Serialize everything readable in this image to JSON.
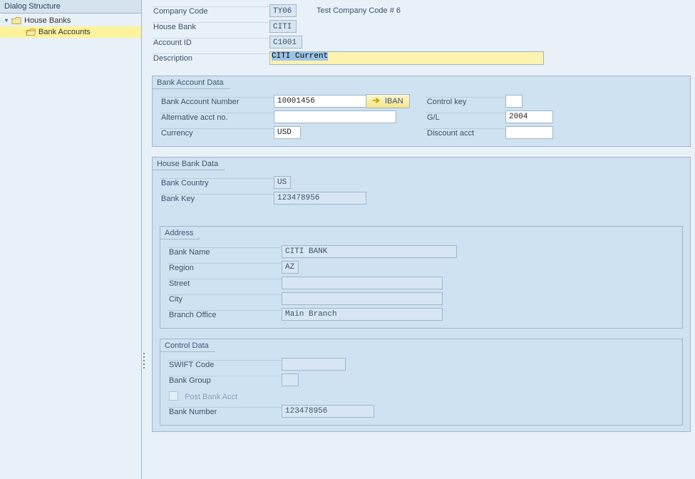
{
  "sidebar": {
    "header": "Dialog Structure",
    "items": [
      {
        "label": "House Banks",
        "expanded": true,
        "selected": false
      },
      {
        "label": "Bank Accounts",
        "expanded": false,
        "selected": true
      }
    ]
  },
  "header_fields": {
    "company_code_label": "Company Code",
    "company_code_value": "TY06",
    "company_code_desc": "Test Company Code # 6",
    "house_bank_label": "House Bank",
    "house_bank_value": "CITI",
    "account_id_label": "Account ID",
    "account_id_value": "C1001",
    "description_label": "Description",
    "description_value": "CITI Current"
  },
  "bank_account_data": {
    "title": "Bank Account Data",
    "bank_account_number_label": "Bank Account Number",
    "bank_account_number_value": "10001456",
    "iban_button": "IBAN",
    "control_key_label": "Control key",
    "control_key_value": "",
    "alt_acct_label": "Alternative acct no.",
    "alt_acct_value": "",
    "gl_label": "G/L",
    "gl_value": "2004",
    "currency_label": "Currency",
    "currency_value": "USD",
    "discount_acct_label": "Discount acct",
    "discount_acct_value": ""
  },
  "house_bank_data": {
    "title": "House Bank Data",
    "bank_country_label": "Bank Country",
    "bank_country_value": "US",
    "bank_key_label": "Bank Key",
    "bank_key_value": "123478956",
    "address": {
      "title": "Address",
      "bank_name_label": "Bank Name",
      "bank_name_value": "CITI BANK",
      "region_label": "Region",
      "region_value": "AZ",
      "street_label": "Street",
      "street_value": "",
      "city_label": "City",
      "city_value": "",
      "branch_office_label": "Branch Office",
      "branch_office_value": "Main Branch"
    },
    "control_data": {
      "title": "Control Data",
      "swift_code_label": "SWIFT Code",
      "swift_code_value": "",
      "bank_group_label": "Bank Group",
      "bank_group_value": "",
      "post_bank_acct_label": "Post Bank Acct",
      "post_bank_acct_checked": false,
      "bank_number_label": "Bank Number",
      "bank_number_value": "123478956"
    }
  }
}
